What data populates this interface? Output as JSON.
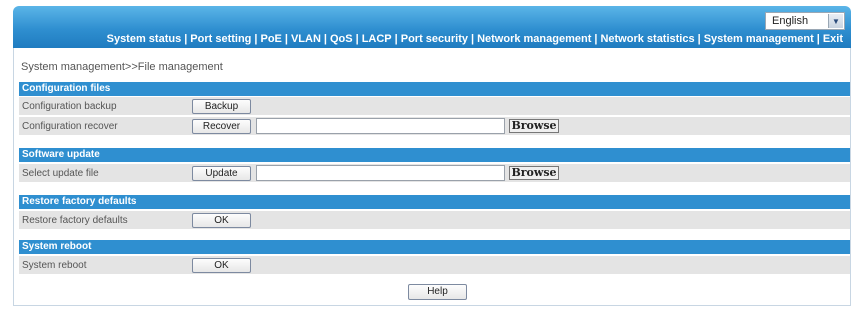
{
  "language": {
    "selected": "English"
  },
  "nav": [
    "System status",
    "Port setting",
    "PoE",
    "VLAN",
    "QoS",
    "LACP",
    "Port security",
    "Network management",
    "Network statistics",
    "System management",
    "Exit"
  ],
  "breadcrumb": "System management>>File management",
  "sections": {
    "config": {
      "title": "Configuration files",
      "backup_label": "Configuration backup",
      "backup_button": "Backup",
      "recover_label": "Configuration recover",
      "recover_button": "Recover",
      "recover_file_value": "",
      "browse": "Browse"
    },
    "software": {
      "title": "Software update",
      "select_label": "Select update file",
      "update_button": "Update",
      "file_value": "",
      "browse": "Browse"
    },
    "factory": {
      "title": "Restore factory defaults",
      "label": "Restore factory defaults",
      "ok_button": "OK"
    },
    "reboot": {
      "title": "System reboot",
      "label": "System reboot",
      "ok_button": "OK"
    }
  },
  "help_button": "Help",
  "colors": {
    "header_blue": "#2f8fd0",
    "row_gray": "#e4e4e4"
  }
}
